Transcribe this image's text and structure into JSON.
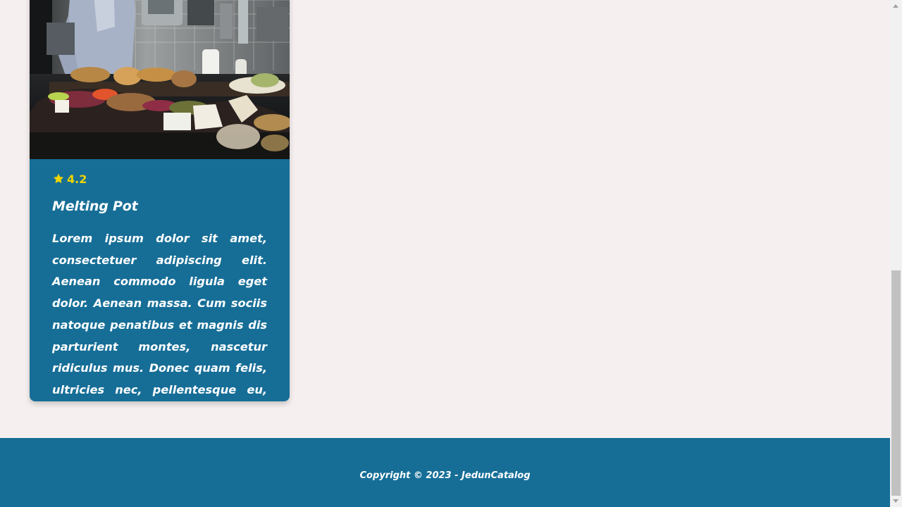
{
  "card": {
    "rating": "4.2",
    "title": "Melting Pot",
    "description": "Lorem ipsum dolor sit amet, consectetuer adipiscing elit. Aenean commodo ligula eget dolor. Aenean massa. Cum sociis natoque penatibus et magnis dis parturient montes, nascetur ridiculus mus. Donec quam felis, ultricies nec, pellentesque eu, pretium ...",
    "image_icon": "restaurant-photo",
    "rating_icon": "star-icon"
  },
  "footer": {
    "copyright": "Copyright © 2023 - JedunCatalog"
  },
  "colors": {
    "background": "#f5f0ef",
    "card": "#166e97",
    "footer": "#166e97",
    "rating": "#f0d500",
    "text": "#ffffff"
  }
}
